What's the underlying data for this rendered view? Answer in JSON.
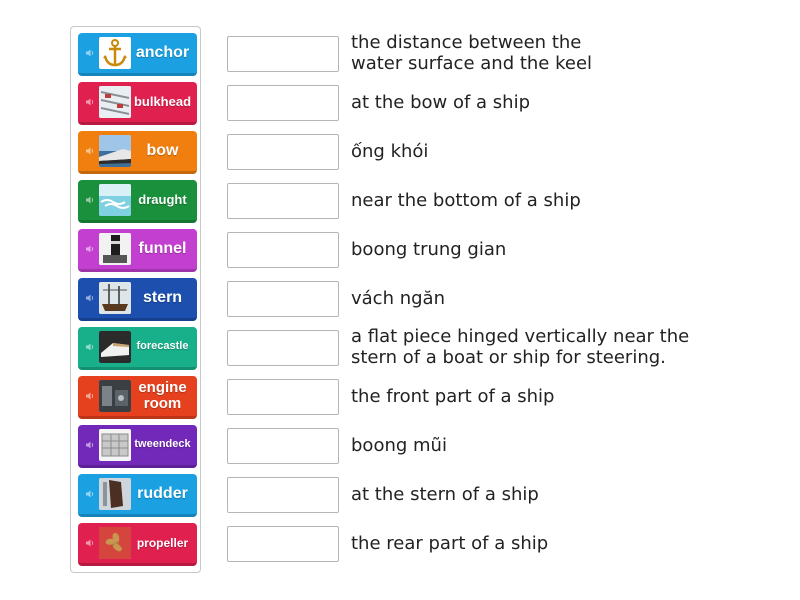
{
  "tiles": [
    {
      "label": "anchor",
      "color": "#1ba1e2",
      "thumb_icon": "anchor-icon"
    },
    {
      "label": "bulkhead",
      "color": "#e0204f",
      "thumb_icon": "bulkhead-photo"
    },
    {
      "label": "bow",
      "color": "#f07f0f",
      "thumb_icon": "bow-photo"
    },
    {
      "label": "draught",
      "color": "#1a8f3c",
      "thumb_icon": "draught-photo"
    },
    {
      "label": "funnel",
      "color": "#c33fcf",
      "thumb_icon": "funnel-photo"
    },
    {
      "label": "stern",
      "color": "#1c4fae",
      "thumb_icon": "stern-photo"
    },
    {
      "label": "forecastle",
      "color": "#18b08a",
      "thumb_icon": "forecastle-photo"
    },
    {
      "label": "engine room",
      "color": "#e5411f",
      "thumb_icon": "engine-room-photo"
    },
    {
      "label": "tweendeck",
      "color": "#7228b8",
      "thumb_icon": "tweendeck-photo"
    },
    {
      "label": "rudder",
      "color": "#1ba1e2",
      "thumb_icon": "rudder-photo"
    },
    {
      "label": "propeller",
      "color": "#e0204f",
      "thumb_icon": "propeller-photo"
    }
  ],
  "definitions": [
    [
      "the distance between the",
      "water surface and the keel"
    ],
    [
      "at the bow of a ship"
    ],
    [
      "ống khói"
    ],
    [
      "near the bottom of a ship"
    ],
    [
      "boong trung gian"
    ],
    [
      "vách ngăn"
    ],
    [
      "a flat piece hinged vertically near the",
      "stern of a boat or ship for steering."
    ],
    [
      "the front part of a ship"
    ],
    [
      "boong mũi"
    ],
    [
      "at the stern of a ship"
    ],
    [
      "the rear part of a ship"
    ]
  ]
}
